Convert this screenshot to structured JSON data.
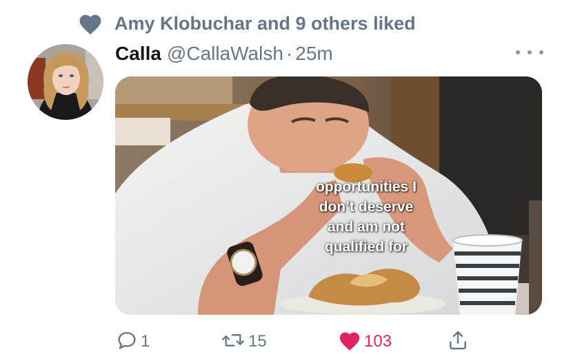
{
  "social_context": {
    "text": "Amy Klobuchar and 9 others liked",
    "icon": "heart-icon"
  },
  "tweet": {
    "display_name": "Calla",
    "handle": "@CallaWalsh",
    "separator": "·",
    "time": "25m",
    "more_icon": "more-horizontal-icon",
    "media": {
      "caption": "opportunities I\ndon’t deserve\nand am not\nqualified for"
    },
    "actions": {
      "reply_count": "1",
      "retweet_count": "15",
      "like_count": "103",
      "liked": true
    }
  },
  "colors": {
    "secondary_text": "#657786",
    "like_red": "#e0245e",
    "heart_context": "#657786"
  }
}
